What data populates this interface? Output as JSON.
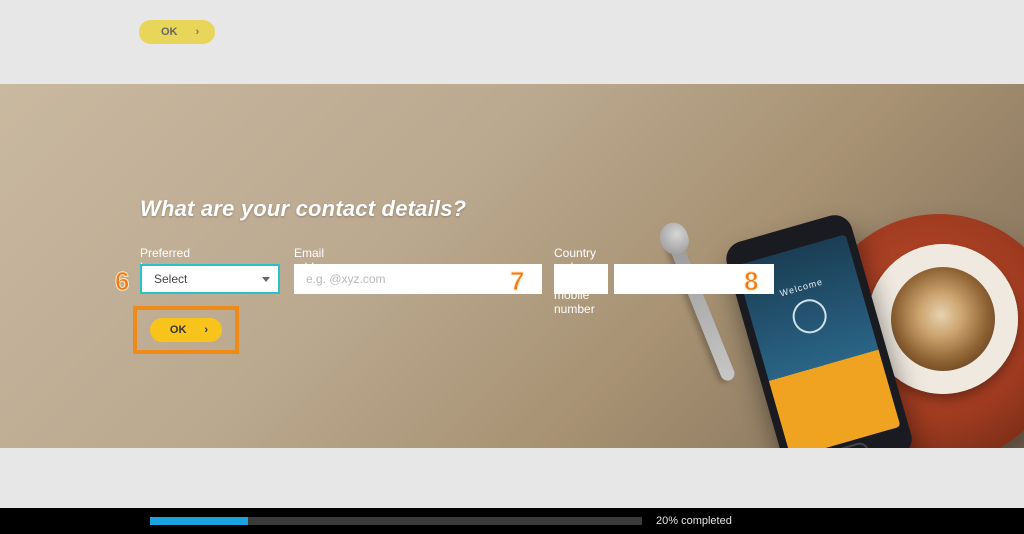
{
  "topButton": {
    "label": "OK",
    "chev": "›"
  },
  "heading": "What are your contact details?",
  "labels": {
    "language": "Preferred language",
    "email": "Email address",
    "phone": "Country code and mobile number"
  },
  "fields": {
    "languageSelected": "Select",
    "emailPlaceholder": "e.g. @xyz.com"
  },
  "okButton": {
    "label": "OK",
    "chev": "›"
  },
  "callouts": {
    "six": "6",
    "seven": "7",
    "eight": "8"
  },
  "phone": {
    "welcome": "Welcome"
  },
  "progress": {
    "percent": 20,
    "label": "20% completed"
  }
}
